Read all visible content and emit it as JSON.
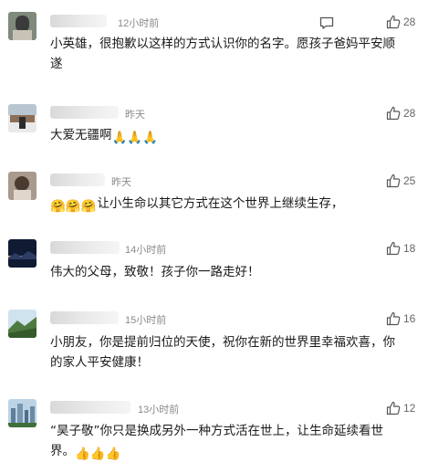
{
  "comments": [
    {
      "time": "12小时前",
      "likes": "28",
      "text": "小英雄，很抱歉以这样的方式认识你的名字。愿孩子爸妈平安顺遂",
      "emoji": "",
      "has_reply": true
    },
    {
      "time": "昨天",
      "likes": "28",
      "text": "大爱无疆啊",
      "emoji": "🙏🙏🙏",
      "has_reply": false
    },
    {
      "time": "昨天",
      "likes": "25",
      "text": "让小生命以其它方式在这个世界上继续生存，",
      "emoji_prefix": "🤗🤗🤗",
      "has_reply": false
    },
    {
      "time": "14小时前",
      "likes": "18",
      "text": "伟大的父母，致敬！孩子你一路走好！",
      "has_reply": false
    },
    {
      "time": "15小时前",
      "likes": "16",
      "text": "小朋友，你是提前归位的天使，祝你在新的世界里幸福欢喜，你的家人平安健康！",
      "has_reply": false
    },
    {
      "time": "13小时前",
      "likes": "12",
      "text": "“昊子敬”你只是换成另外一种方式活在世上，让生命延续看世界。",
      "emoji": "👍👍👍",
      "has_reply": false
    }
  ],
  "icons": {
    "reply": "comment-icon",
    "like": "thumbs-up-icon"
  },
  "colors": {
    "text": "#1a1a1a",
    "meta": "#8a8a8a",
    "icon": "#555555"
  }
}
